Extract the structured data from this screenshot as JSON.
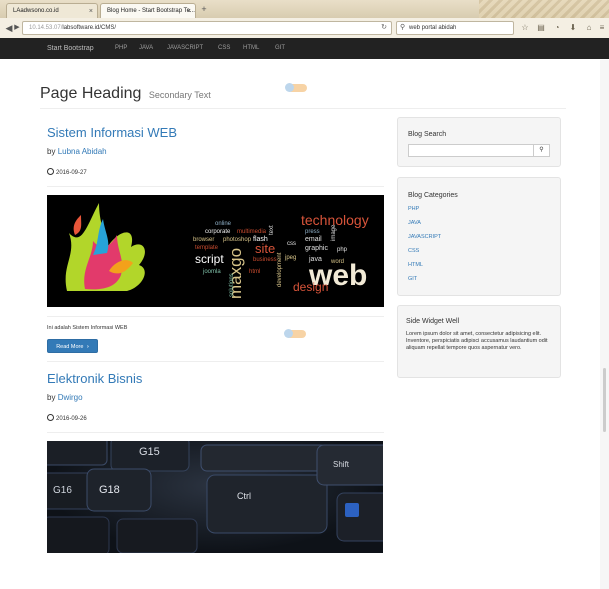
{
  "browser": {
    "tabs": [
      {
        "label": "LAadwsono.co.id"
      },
      {
        "label": "Blog Home - Start Bootstrap Te..."
      }
    ],
    "new_tab": "+",
    "url_grey": "10.14.53.07/",
    "url_main": "labsoftware.id/CMS/",
    "search_value": "web portal abidah"
  },
  "site_nav": {
    "brand": "Start Bootstrap",
    "links": [
      "PHP",
      "JAVA",
      "JAVASCRIPT",
      "CSS",
      "HTML",
      "GIT"
    ]
  },
  "page_heading": {
    "title": "Page Heading",
    "subtitle": "Secondary Text"
  },
  "posts": [
    {
      "title": "Sistem Informasi WEB",
      "by": "by",
      "author": "Lubna Abidah",
      "date": "2016-09-27",
      "excerpt": "Ini adalah Sistem Informasi WEB",
      "button": "Read More",
      "image_words": [
        "technology",
        "online",
        "corporate",
        "multimedia",
        "browser",
        "photoshop",
        "flash",
        "template",
        "site",
        "css",
        "email",
        "press",
        "graphic",
        "script",
        "business",
        "jpeg",
        "php",
        "web",
        "joomla",
        "maxgo",
        "solutions",
        "html",
        "development",
        "design",
        "java",
        "word",
        "image",
        "text"
      ]
    },
    {
      "title": "Elektronik Bisnis",
      "by": "by",
      "author": "Dwirgo",
      "date": "2016-09-26",
      "image_keys": [
        "G15",
        "G16",
        "G18",
        "Ctrl",
        "Shift"
      ]
    }
  ],
  "sidebar": {
    "search_title": "Blog Search",
    "search_button_icon": "search-icon",
    "categories_title": "Blog Categories",
    "categories": [
      "PHP",
      "JAVA",
      "JAVASCRIPT",
      "CSS",
      "HTML",
      "GIT"
    ],
    "widget_title": "Side Widget Well",
    "widget_text": "Lorem ipsum dolor sit amet, consectetur adipisicing elit. Inventore, perspiciatis adipisci accusamus laudantium odit aliquam repellat tempore quos aspernatur vero."
  },
  "colors": {
    "link": "#337ab7",
    "navbar_bg": "#222222",
    "well_bg": "#f5f5f5"
  }
}
